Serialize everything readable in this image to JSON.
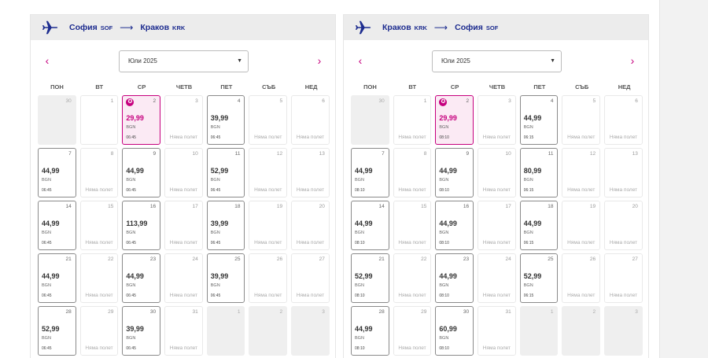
{
  "panels": [
    {
      "origin_city": "София",
      "origin_code": "SOF",
      "dest_city": "Краков",
      "dest_code": "KRK",
      "month_label": "Юли 2025",
      "weekdays": [
        "ПОН",
        "ВТ",
        "СР",
        "ЧЕТВ",
        "ПЕТ",
        "СЪБ",
        "НЕД"
      ],
      "days": [
        {
          "day": "30",
          "type": "other"
        },
        {
          "day": "1",
          "type": "noflight"
        },
        {
          "day": "2",
          "type": "selected",
          "price": "29,99",
          "currency": "BGN",
          "time": "06:45"
        },
        {
          "day": "3",
          "type": "noflight",
          "text": "Няма полет"
        },
        {
          "day": "4",
          "type": "flight",
          "price": "39,99",
          "currency": "BGN",
          "time": "06:45"
        },
        {
          "day": "5",
          "type": "noflight",
          "text": "Няма полет"
        },
        {
          "day": "6",
          "type": "noflight",
          "text": "Няма полет"
        },
        {
          "day": "7",
          "type": "flight",
          "price": "44,99",
          "currency": "BGN",
          "time": "06:45"
        },
        {
          "day": "8",
          "type": "noflight",
          "text": "Няма полет"
        },
        {
          "day": "9",
          "type": "flight",
          "price": "44,99",
          "currency": "BGN",
          "time": "06:45"
        },
        {
          "day": "10",
          "type": "noflight",
          "text": "Няма полет"
        },
        {
          "day": "11",
          "type": "flight",
          "price": "52,99",
          "currency": "BGN",
          "time": "06:45"
        },
        {
          "day": "12",
          "type": "noflight",
          "text": "Няма полет"
        },
        {
          "day": "13",
          "type": "noflight",
          "text": "Няма полет"
        },
        {
          "day": "14",
          "type": "flight",
          "price": "44,99",
          "currency": "BGN",
          "time": "06:45"
        },
        {
          "day": "15",
          "type": "noflight",
          "text": "Няма полет"
        },
        {
          "day": "16",
          "type": "flight",
          "price": "113,99",
          "currency": "BGN",
          "time": "06:45"
        },
        {
          "day": "17",
          "type": "noflight",
          "text": "Няма полет"
        },
        {
          "day": "18",
          "type": "flight",
          "price": "39,99",
          "currency": "BGN",
          "time": "06:45"
        },
        {
          "day": "19",
          "type": "noflight",
          "text": "Няма полет"
        },
        {
          "day": "20",
          "type": "noflight",
          "text": "Няма полет"
        },
        {
          "day": "21",
          "type": "flight",
          "price": "44,99",
          "currency": "BGN",
          "time": "06:45"
        },
        {
          "day": "22",
          "type": "noflight",
          "text": "Няма полет"
        },
        {
          "day": "23",
          "type": "flight",
          "price": "44,99",
          "currency": "BGN",
          "time": "06:45"
        },
        {
          "day": "24",
          "type": "noflight",
          "text": "Няма полет"
        },
        {
          "day": "25",
          "type": "flight",
          "price": "39,99",
          "currency": "BGN",
          "time": "06:45"
        },
        {
          "day": "26",
          "type": "noflight",
          "text": "Няма полет"
        },
        {
          "day": "27",
          "type": "noflight",
          "text": "Няма полет"
        },
        {
          "day": "28",
          "type": "flight",
          "price": "52,99",
          "currency": "BGN",
          "time": "06:45"
        },
        {
          "day": "29",
          "type": "noflight",
          "text": "Няма полет"
        },
        {
          "day": "30",
          "type": "flight",
          "price": "39,99",
          "currency": "BGN",
          "time": "06:45"
        },
        {
          "day": "31",
          "type": "noflight",
          "text": "Няма полет"
        },
        {
          "day": "1",
          "type": "other"
        },
        {
          "day": "2",
          "type": "other"
        },
        {
          "day": "3",
          "type": "other"
        }
      ]
    },
    {
      "origin_city": "Краков",
      "origin_code": "KRK",
      "dest_city": "София",
      "dest_code": "SOF",
      "month_label": "Юли 2025",
      "weekdays": [
        "ПОН",
        "ВТ",
        "СР",
        "ЧЕТВ",
        "ПЕТ",
        "СЪБ",
        "НЕД"
      ],
      "days": [
        {
          "day": "30",
          "type": "other"
        },
        {
          "day": "1",
          "type": "noflight",
          "text": "Няма полет"
        },
        {
          "day": "2",
          "type": "selected",
          "price": "29,99",
          "currency": "BGN",
          "time": "08:10"
        },
        {
          "day": "3",
          "type": "noflight",
          "text": "Няма полет"
        },
        {
          "day": "4",
          "type": "flight",
          "price": "44,99",
          "currency": "BGN",
          "time": "06:15"
        },
        {
          "day": "5",
          "type": "noflight",
          "text": "Няма полет"
        },
        {
          "day": "6",
          "type": "noflight",
          "text": "Няма полет"
        },
        {
          "day": "7",
          "type": "flight",
          "price": "44,99",
          "currency": "BGN",
          "time": "08:10"
        },
        {
          "day": "8",
          "type": "noflight",
          "text": "Няма полет"
        },
        {
          "day": "9",
          "type": "flight",
          "price": "44,99",
          "currency": "BGN",
          "time": "08:10"
        },
        {
          "day": "10",
          "type": "noflight",
          "text": "Няма полет"
        },
        {
          "day": "11",
          "type": "flight",
          "price": "80,99",
          "currency": "BGN",
          "time": "06:15"
        },
        {
          "day": "12",
          "type": "noflight",
          "text": "Няма полет"
        },
        {
          "day": "13",
          "type": "noflight",
          "text": "Няма полет"
        },
        {
          "day": "14",
          "type": "flight",
          "price": "44,99",
          "currency": "BGN",
          "time": "08:10"
        },
        {
          "day": "15",
          "type": "noflight",
          "text": "Няма полет"
        },
        {
          "day": "16",
          "type": "flight",
          "price": "44,99",
          "currency": "BGN",
          "time": "08:10"
        },
        {
          "day": "17",
          "type": "noflight",
          "text": "Няма полет"
        },
        {
          "day": "18",
          "type": "flight",
          "price": "44,99",
          "currency": "BGN",
          "time": "06:15"
        },
        {
          "day": "19",
          "type": "noflight",
          "text": "Няма полет"
        },
        {
          "day": "20",
          "type": "noflight",
          "text": "Няма полет"
        },
        {
          "day": "21",
          "type": "flight",
          "price": "52,99",
          "currency": "BGN",
          "time": "08:10"
        },
        {
          "day": "22",
          "type": "noflight",
          "text": "Няма полет"
        },
        {
          "day": "23",
          "type": "flight",
          "price": "44,99",
          "currency": "BGN",
          "time": "08:10"
        },
        {
          "day": "24",
          "type": "noflight",
          "text": "Няма полет"
        },
        {
          "day": "25",
          "type": "flight",
          "price": "52,99",
          "currency": "BGN",
          "time": "06:15"
        },
        {
          "day": "26",
          "type": "noflight",
          "text": "Няма полет"
        },
        {
          "day": "27",
          "type": "noflight",
          "text": "Няма полет"
        },
        {
          "day": "28",
          "type": "flight",
          "price": "44,99",
          "currency": "BGN",
          "time": "08:10"
        },
        {
          "day": "29",
          "type": "noflight",
          "text": "Няма полет"
        },
        {
          "day": "30",
          "type": "flight",
          "price": "60,99",
          "currency": "BGN",
          "time": "08:10"
        },
        {
          "day": "31",
          "type": "noflight",
          "text": "Няма полет"
        },
        {
          "day": "1",
          "type": "other"
        },
        {
          "day": "2",
          "type": "other"
        },
        {
          "day": "3",
          "type": "other"
        }
      ]
    }
  ],
  "icons": {
    "prev": "chevron-left-icon",
    "next": "chevron-right-icon",
    "plane": "plane-icon",
    "arrow": "long-arrow-right-icon",
    "star": "star-badge-icon",
    "caret": "caret-down-icon"
  },
  "colors": {
    "brand_blue": "#1d2c8f",
    "accent_pink": "#c6007e",
    "selected_bg": "#fbeaf4"
  }
}
